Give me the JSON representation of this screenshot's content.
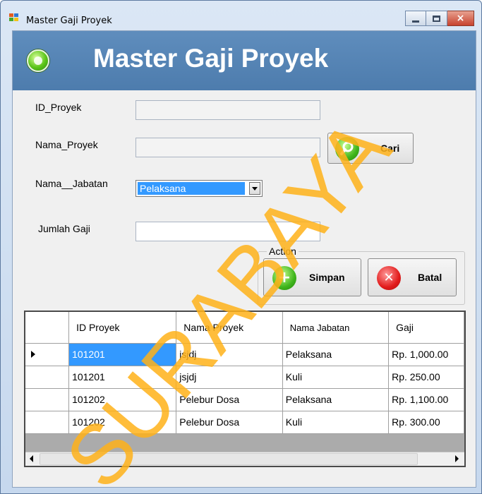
{
  "window": {
    "title": "Master Gaji Proyek",
    "controls": {
      "minimize": "minimize",
      "maximize": "maximize",
      "close": "×"
    }
  },
  "header": {
    "title": "Master Gaji Proyek"
  },
  "form": {
    "id_proyek_label": "ID_Proyek",
    "id_proyek_value": "",
    "nama_proyek_label": "Nama_Proyek",
    "nama_proyek_value": "",
    "cari_button": "Cari",
    "nama_jabatan_label": "Nama__Jabatan",
    "nama_jabatan_value": "Pelaksana",
    "jumlah_gaji_label": "Jumlah Gaji",
    "jumlah_gaji_value": ""
  },
  "action_group": {
    "title": "Action",
    "simpan_button": "Simpan",
    "batal_button": "Batal"
  },
  "grid": {
    "columns": [
      "ID Proyek",
      "Nama Proyek",
      "Nama Jabatan",
      "Gaji"
    ],
    "rows": [
      [
        "101201",
        "jsjdj",
        "Pelaksana",
        "Rp. 1,000.00"
      ],
      [
        "101201",
        "jsjdj",
        "Kuli",
        "Rp. 250.00"
      ],
      [
        "101202",
        "Pelebur Dosa",
        "Pelaksana",
        "Rp. 1,100.00"
      ],
      [
        "101202",
        "Pelebur Dosa",
        "Kuli",
        "Rp. 300.00"
      ]
    ],
    "selected_row": 0
  },
  "watermark": {
    "text": "SURABAYA"
  },
  "colors": {
    "header_bg": "#5585b8",
    "selection": "#3399ff",
    "watermark": "#ffb21a"
  },
  "icons": {
    "app": "app-window-icon",
    "header": "flower-logo-icon",
    "cari": "search-icon",
    "simpan": "plus-icon",
    "batal": "x-icon"
  }
}
